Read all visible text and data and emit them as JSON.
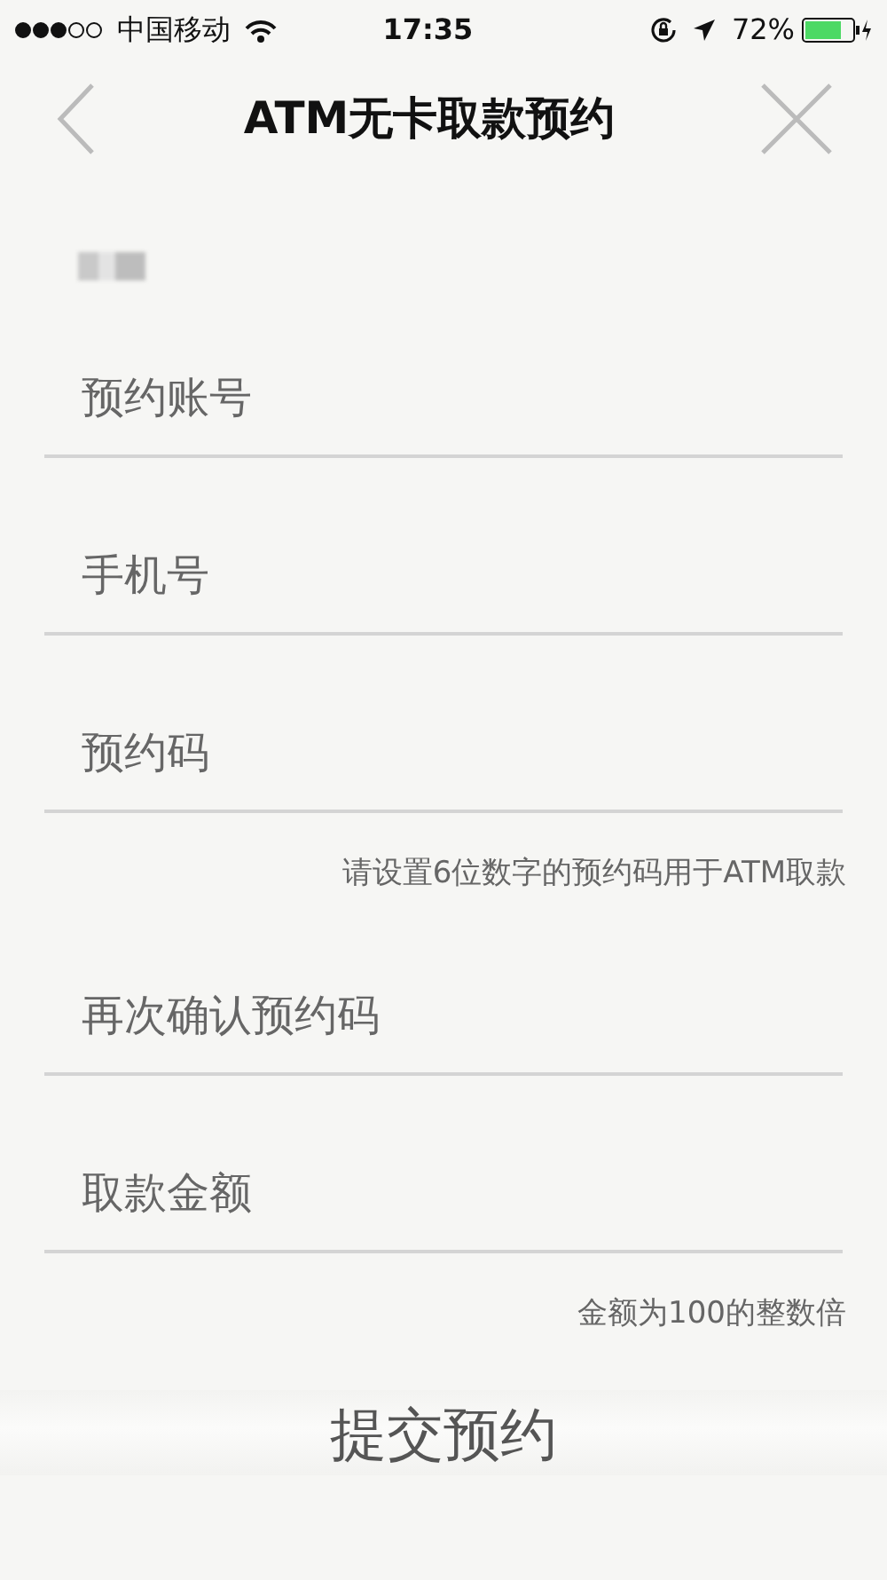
{
  "status_bar": {
    "carrier": "中国移动",
    "time": "17:35",
    "battery": "72%"
  },
  "nav": {
    "title": "ATM无卡取款预约"
  },
  "fields": [
    {
      "placeholder": "预约账号"
    },
    {
      "placeholder": "手机号"
    },
    {
      "placeholder": "预约码",
      "hint": "请设置6位数字的预约码用于ATM取款"
    },
    {
      "placeholder": "再次确认预约码"
    },
    {
      "placeholder": "取款金额",
      "hint": "金额为100的整数倍"
    }
  ],
  "submit": {
    "label": "提交预约"
  }
}
